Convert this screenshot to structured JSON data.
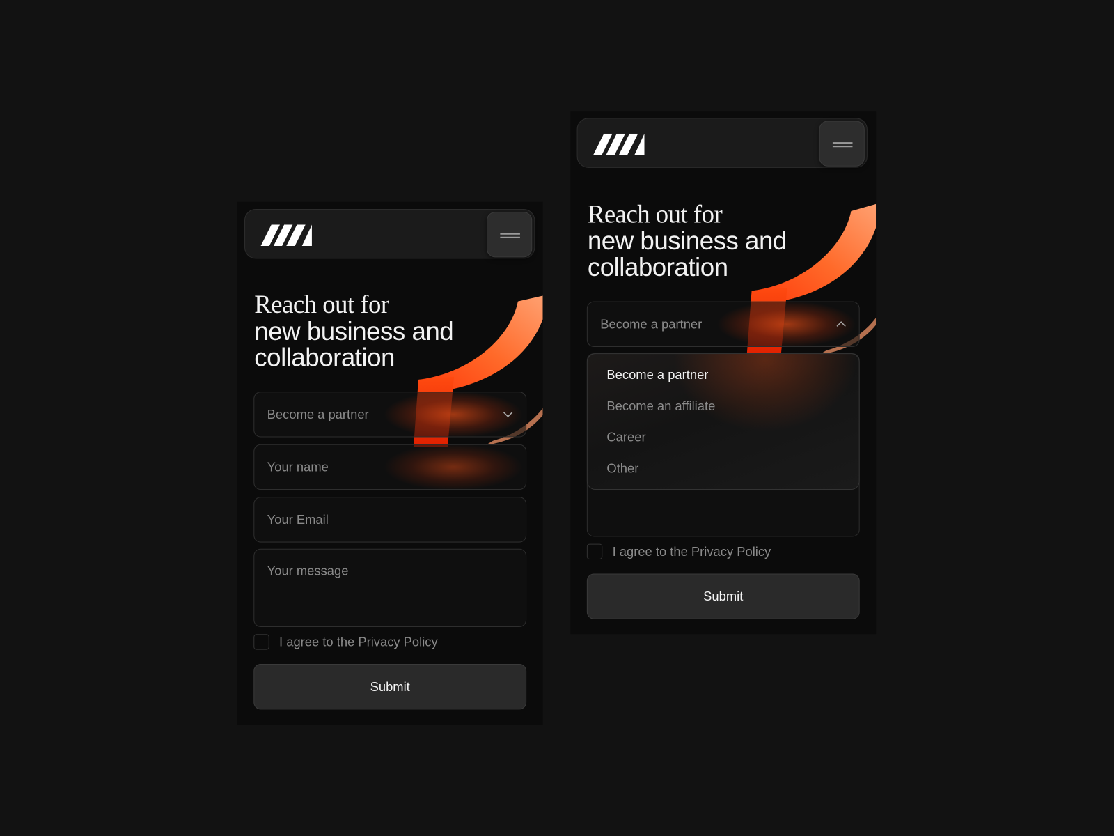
{
  "brand": {
    "logo": "MM",
    "accent": "#ff4a14"
  },
  "screens": [
    {
      "heading": {
        "line1": "Reach out for",
        "line2": "new business and",
        "line3": "collaboration"
      },
      "form": {
        "topic_select": {
          "value": "Become a partner",
          "state": "closed"
        },
        "name_placeholder": "Your name",
        "email_placeholder": "Your Email",
        "message_placeholder": "Your message",
        "privacy_label": "I agree to the Privacy Policy",
        "privacy_checked": false,
        "submit_label": "Submit"
      }
    },
    {
      "heading": {
        "line1": "Reach out for",
        "line2": "new business and",
        "line3": "collaboration"
      },
      "form": {
        "topic_select": {
          "value": "Become a partner",
          "state": "open",
          "options": [
            "Become a partner",
            "Become an affiliate",
            "Career",
            "Other"
          ],
          "selected_index": 0
        },
        "privacy_label": "I agree to the Privacy Policy",
        "privacy_checked": false,
        "submit_label": "Submit"
      }
    }
  ]
}
